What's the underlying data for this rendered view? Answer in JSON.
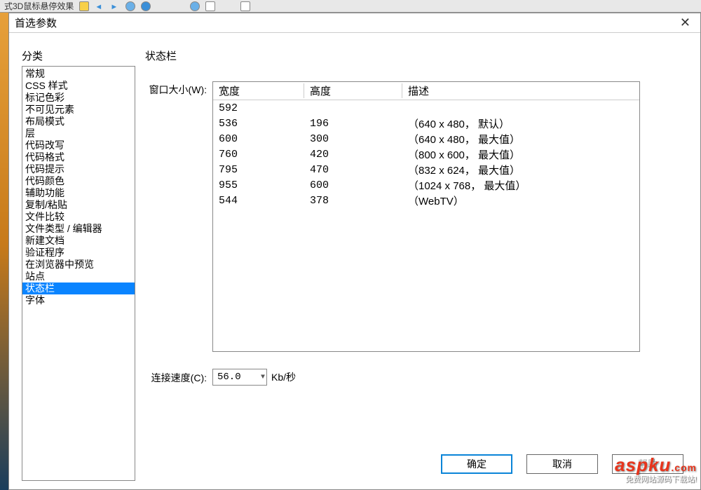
{
  "background_tab_title": "式3D鼠标悬停效果",
  "dialog": {
    "title": "首选参数",
    "category_label": "分类",
    "categories": [
      "常规",
      "CSS 样式",
      "标记色彩",
      "不可见元素",
      "布局模式",
      "层",
      "代码改写",
      "代码格式",
      "代码提示",
      "代码颜色",
      "辅助功能",
      "复制/粘贴",
      "文件比较",
      "文件类型 / 编辑器",
      "新建文档",
      "验证程序",
      "在浏览器中预览",
      "站点",
      "状态栏",
      "字体"
    ],
    "selected_category_index": 18,
    "panel_title": "状态栏",
    "window_size_label": "窗口大小(W):",
    "table_headers": {
      "width": "宽度",
      "height": "高度",
      "description": "描述"
    },
    "rows": [
      {
        "width": "592",
        "height": "",
        "desc": ""
      },
      {
        "width": "536",
        "height": "196",
        "desc": "（640 x 480， 默认）"
      },
      {
        "width": "600",
        "height": "300",
        "desc": "（640 x 480， 最大值）"
      },
      {
        "width": "760",
        "height": "420",
        "desc": "（800 x 600， 最大值）"
      },
      {
        "width": "795",
        "height": "470",
        "desc": "（832 x 624， 最大值）"
      },
      {
        "width": "955",
        "height": "600",
        "desc": "（1024 x 768， 最大值）"
      },
      {
        "width": "544",
        "height": "378",
        "desc": "（WebTV）"
      }
    ],
    "connection_speed_label": "连接速度(C):",
    "connection_speed_value": "56.0",
    "connection_speed_unit": "Kb/秒",
    "buttons": {
      "ok": "确定",
      "cancel": "取消",
      "help": "帮助"
    }
  },
  "watermark": {
    "main": "aspku",
    "suffix": ".com",
    "sub": "免费网站源码下载站!"
  }
}
